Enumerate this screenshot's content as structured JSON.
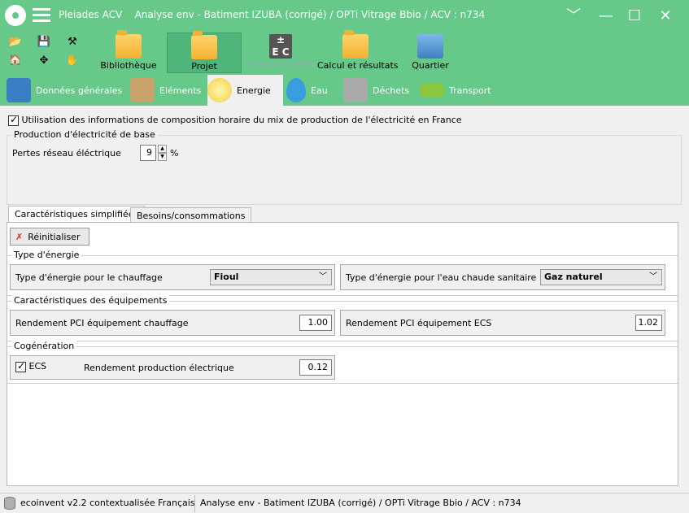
{
  "window": {
    "app_name": "Pleiades ACV",
    "title": "Analyse env - Batiment  IZUBA (corrigé) / OPTi Vitrage Bbio / ACV : n734",
    "controls": [
      "chevron-down",
      "minimize",
      "maximize",
      "close"
    ]
  },
  "ribbon": {
    "buttons": [
      {
        "label": "Bibliothèque",
        "icon": "folder-books-icon",
        "active": false,
        "disabled": false
      },
      {
        "label": "Projet",
        "icon": "folder-house-icon",
        "active": true,
        "disabled": false
      },
      {
        "label": "Enveloppe du bâtiment",
        "icon": "ec-calculator-icon",
        "active": false,
        "disabled": true
      },
      {
        "label": "Calcul et résultats",
        "icon": "folder-results-icon",
        "active": false,
        "disabled": false
      },
      {
        "label": "Quartier",
        "icon": "district-icon",
        "active": false,
        "disabled": false
      }
    ]
  },
  "tabs": [
    {
      "label": "Données générales",
      "icon": "general-data-icon"
    },
    {
      "label": "Eléments",
      "icon": "house-icon"
    },
    {
      "label": "Energie",
      "icon": "lightbulb-icon",
      "active": true
    },
    {
      "label": "Eau",
      "icon": "water-drop-icon"
    },
    {
      "label": "Déchets",
      "icon": "trash-can-icon"
    },
    {
      "label": "Transport",
      "icon": "car-icon"
    }
  ],
  "energie": {
    "hourly_mix_checkbox_label": "Utilisation des informations de composition horaire du mix de production de l'électricité en France",
    "hourly_mix_checked": true,
    "base_production_legend": "Production d'électricité de base",
    "network_loss_label": "Pertes réseau éléctrique",
    "network_loss_value": "9",
    "network_loss_unit": "%",
    "subtabs": [
      "Caractéristiques simplifiées",
      "Besoins/consommations"
    ],
    "reset_button": "Réinitialiser",
    "energy_type_legend": "Type d'énergie",
    "heating_energy_label": "Type d'énergie pour le chauffage",
    "heating_energy_value": "Fioul",
    "dhw_energy_label": "Type d'énergie pour l'eau chaude sanitaire",
    "dhw_energy_value": "Gaz naturel",
    "equipment_legend": "Caractéristiques des équipements",
    "heating_efficiency_label": "Rendement PCI équipement chauffage",
    "heating_efficiency_value": "1.00",
    "dhw_efficiency_label": "Rendement PCI équipement ECS",
    "dhw_efficiency_value": "1.02",
    "cogeneration_legend": "Cogénération",
    "ecs_checkbox_label": "ECS",
    "ecs_checked": true,
    "elec_production_label": "Rendement production électrique",
    "elec_production_value": "0.12"
  },
  "statusbar": {
    "database": "ecoinvent v2.2 contextualisée Français",
    "project_path": "Analyse env - Batiment  IZUBA (corrigé) / OPTi Vitrage Bbio / ACV : n734"
  }
}
